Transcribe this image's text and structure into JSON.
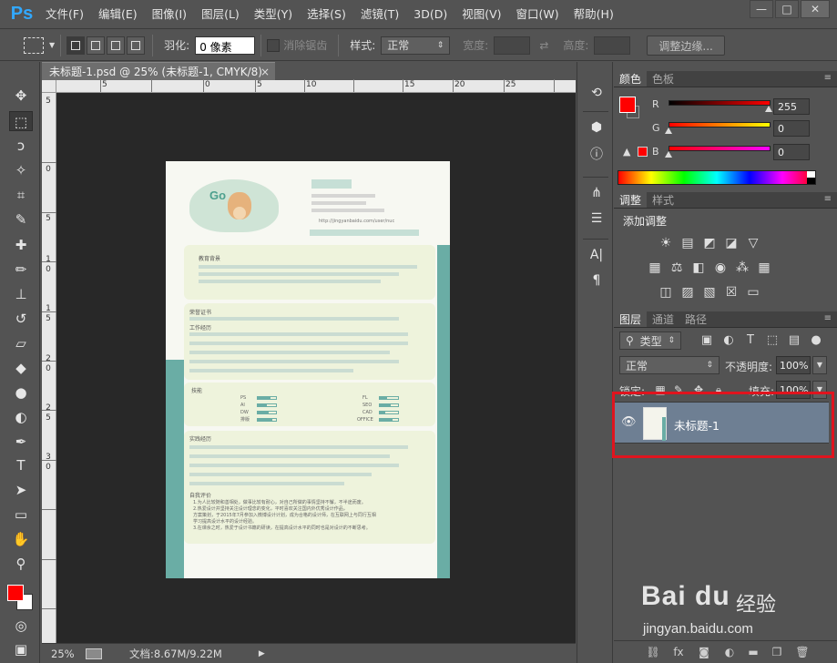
{
  "app": {
    "logo": "Ps",
    "menu": [
      "文件(F)",
      "编辑(E)",
      "图像(I)",
      "图层(L)",
      "类型(Y)",
      "选择(S)",
      "滤镜(T)",
      "3D(D)",
      "视图(V)",
      "窗口(W)",
      "帮助(H)"
    ],
    "window_controls": [
      "—",
      "□",
      "✕"
    ]
  },
  "options": {
    "feather_label": "羽化:",
    "feather_value": "0 像素",
    "antialias_label": "消除锯齿",
    "style_label": "样式:",
    "style_value": "正常",
    "width_label": "宽度:",
    "height_label": "高度:",
    "refine_edge_label": "调整边缘..."
  },
  "document": {
    "tab_title": "未标题-1.psd @ 25% (未标题-1, CMYK/8)",
    "tab_close": "×",
    "ruler_h": [
      "5",
      "0",
      "5",
      "10",
      "15",
      "20",
      "25"
    ],
    "ruler_v": [
      "5",
      "0",
      "5",
      "1\n0",
      "1\n5",
      "2\n0",
      "2\n5",
      "3\n0"
    ],
    "resume": {
      "go_text": "Go",
      "url": "http://jingyanbaidu.com/user/nuc",
      "section_education": "教育背景",
      "section_cert": "荣誉证书",
      "section_work": "工作经历",
      "section_skills": "技能",
      "section_practice": "实践经历",
      "section_self": "自我评价",
      "skill_labels": [
        "PS",
        "AI",
        "DW",
        "排版",
        "FL",
        "SEO",
        "CAD",
        "OFFICE"
      ],
      "skill_levels": [
        0.7,
        0.5,
        0.6,
        0.8,
        0.4,
        0.6,
        0.3,
        0.7
      ],
      "self_eval_lines": [
        "1.为人比较随和善相处，做事比较有耐心，对自己所做的事情坚持不懈，不半途而废。",
        "2.热爱设计并坚持关注设计理念的变化，平时喜欢关注国内外优秀设计作品，",
        "方案策划，于2015年7月参加入微博设计计划，成为合格的设计师，在互联网上与同行互相",
        "学习提高设计水平的设计经验。",
        "3.在课余之时，热爱于设计书籍的研读，在提高设计水平的同时也是对设计的不断思考。"
      ]
    }
  },
  "status": {
    "zoom": "25%",
    "doc_size": "文档:8.67M/9.22M"
  },
  "color_panel": {
    "tabs": [
      "颜色",
      "色板"
    ],
    "labels": [
      "R",
      "G",
      "B"
    ],
    "values": [
      "255",
      "0",
      "0"
    ],
    "foreground": "#ff0000"
  },
  "adjust_panel": {
    "tabs": [
      "调整",
      "样式"
    ],
    "title": "添加调整"
  },
  "layers_panel": {
    "tabs": [
      "图层",
      "通道",
      "路径"
    ],
    "filter_label": "类型",
    "blend_mode": "正常",
    "opacity_label": "不透明度:",
    "opacity_value": "100%",
    "lock_label": "锁定:",
    "fill_label": "填充:",
    "fill_value": "100%",
    "layer_name": "未标题-1"
  },
  "watermark": {
    "logo": "Bai du",
    "product": "经验",
    "url": "jingyan.baidu.com"
  },
  "colors": {
    "accent_red": "#ff0000",
    "highlight_box": "#e0141e",
    "resume_teal": "#6aada5",
    "selected_layer": "#6e7f93"
  }
}
